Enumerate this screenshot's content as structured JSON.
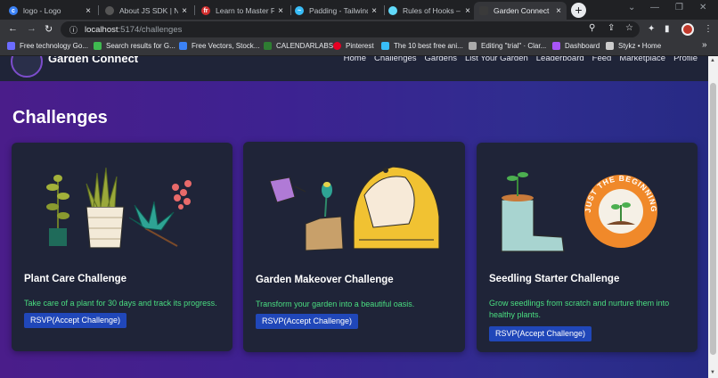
{
  "browser": {
    "tabs": [
      {
        "title": "logo - Logo",
        "active": false
      },
      {
        "title": "About JS SDK | NEAR",
        "active": false
      },
      {
        "title": "Learn to Master Fr",
        "active": false
      },
      {
        "title": "Padding - Tailwind",
        "active": false
      },
      {
        "title": "Rules of Hooks – R",
        "active": false
      },
      {
        "title": "Garden Connect",
        "active": true
      }
    ],
    "url_host": "localhost",
    "url_path": ":5174/challenges",
    "bookmarks": [
      {
        "label": "Free technology Go...",
        "color": "#6c6cff"
      },
      {
        "label": "Search results for G...",
        "color": "#3fb950"
      },
      {
        "label": "Free Vectors, Stock...",
        "color": "#3b82f6"
      },
      {
        "label": "CALENDARLABS",
        "color": "#2e7d32"
      },
      {
        "label": "Pinterest",
        "color": "#e60023"
      },
      {
        "label": "The 10 best free ani...",
        "color": "#38bdf8"
      },
      {
        "label": "Editing \"trial\" · Clar...",
        "color": "#aaaaaa"
      },
      {
        "label": "Dashboard",
        "color": "#a855f7"
      },
      {
        "label": "Stykz • Home",
        "color": "#cccccc"
      }
    ],
    "bookmarks_overflow": "»"
  },
  "app": {
    "brand": "Garden Connect",
    "nav": [
      "Home",
      "Challenges",
      "Gardens",
      "List Your Garden",
      "Leaderboard",
      "Feed",
      "Marketplace",
      "Profile"
    ],
    "heading": "Challenges",
    "challenges": [
      {
        "title": "Plant Care Challenge",
        "description": "Take care of a plant for 30 days and track its progress.",
        "button": "RSVP(Accept Challenge)"
      },
      {
        "title": "Garden Makeover Challenge",
        "description": "Transform your garden into a beautiful oasis.",
        "button": "RSVP(Accept Challenge)"
      },
      {
        "title": "Seedling Starter Challenge",
        "description": "Grow seedlings from scratch and nurture them into healthy plants.",
        "button": "RSVP(Accept Challenge)",
        "badge_text": "JUST THE BEGINNING"
      }
    ]
  },
  "colors": {
    "accent_button": "#2047b9",
    "desc_green": "#4ade80",
    "card_bg": "#1f2438"
  }
}
